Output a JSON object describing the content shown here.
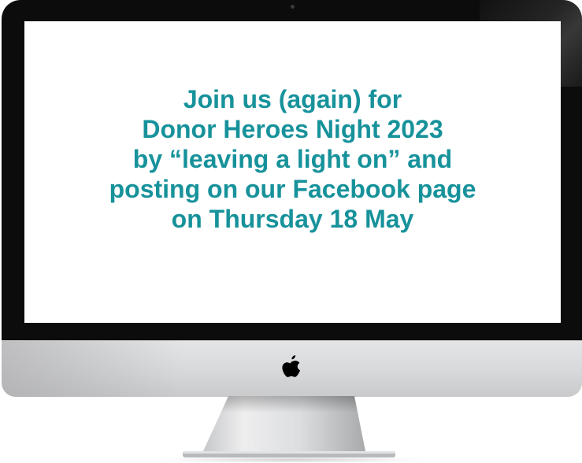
{
  "screen": {
    "message_lines": [
      "Join us (again) for",
      "Donor Heroes Night 2023",
      "by “leaving a light on” and",
      "posting on our Facebook page",
      "on Thursday 18 May"
    ],
    "text_color": "#17929b"
  },
  "device": {
    "type": "desktop monitor",
    "logo_icon": "apple-logo-icon",
    "bezel_color": "#0c0c0c",
    "chin_color": "#d7d8da"
  }
}
